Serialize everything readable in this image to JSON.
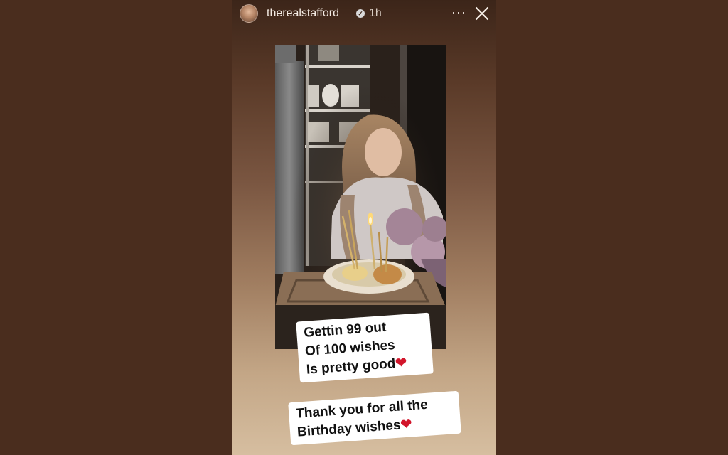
{
  "story": {
    "username": "therealstafford",
    "time": "1h",
    "more_label": "···"
  },
  "captions": {
    "line1": "Gettin 99 out",
    "line2": "Of 100 wishes",
    "line3": "Is pretty good",
    "line4": "Thank you for all the",
    "line5": "Birthday wishes",
    "heart": "❤"
  },
  "colors": {
    "backdrop": "#4a2d1e",
    "heart": "#d2152b"
  }
}
